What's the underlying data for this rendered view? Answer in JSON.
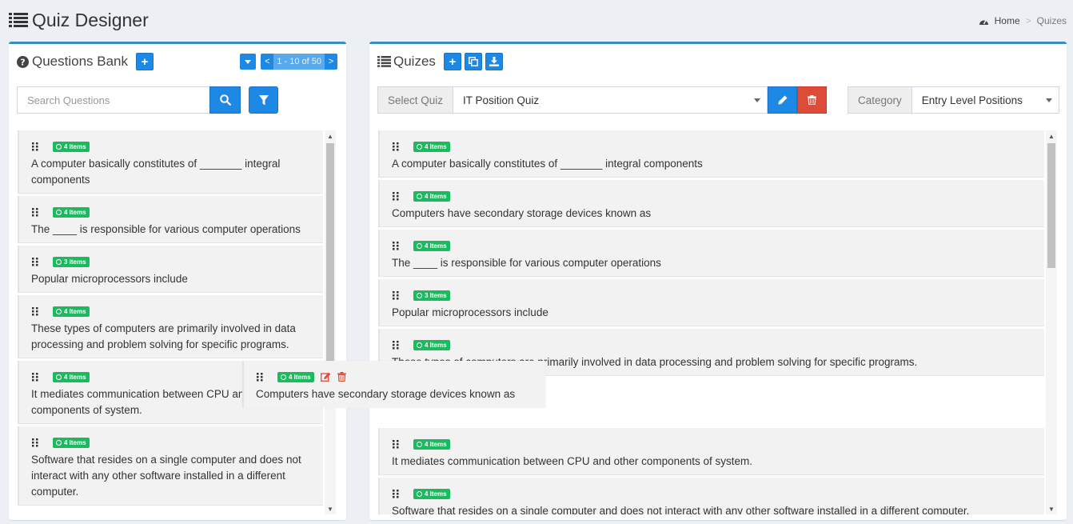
{
  "header": {
    "title": "Quiz Designer"
  },
  "breadcrumb": {
    "home": "Home",
    "current": "Quizes"
  },
  "left_panel": {
    "title": "Questions Bank",
    "pagination": {
      "prev": "<",
      "range": "1 - 10 of 50",
      "next": ">"
    },
    "search_placeholder": "Search Questions",
    "questions": [
      {
        "badge": "4 Items",
        "text": "A computer basically constitutes of _______ integral components"
      },
      {
        "badge": "4 Items",
        "text": "The ____ is responsible for various computer operations"
      },
      {
        "badge": "3 Items",
        "text": "Popular microprocessors include"
      },
      {
        "badge": "4 Items",
        "text": "These types of computers are primarily involved in data processing and problem solving for specific programs."
      },
      {
        "badge": "4 Items",
        "text": "It mediates communication between CPU and other components of system."
      },
      {
        "badge": "4 Items",
        "text": "Software that resides on a single computer and does not interact with any other software installed in a different computer."
      }
    ]
  },
  "right_panel": {
    "title": "Quizes",
    "select_quiz_label": "Select Quiz",
    "selected_quiz": "IT Position Quiz",
    "category_label": "Category",
    "selected_category": "Entry Level Positions",
    "questions": [
      {
        "badge": "4 Items",
        "text": "A computer basically constitutes of _______ integral components"
      },
      {
        "badge": "4 Items",
        "text": "Computers have secondary storage devices known as"
      },
      {
        "badge": "4 Items",
        "text": "The ____ is responsible for various computer operations"
      },
      {
        "badge": "3 Items",
        "text": "Popular microprocessors include"
      },
      {
        "badge": "4 Items",
        "text": "These types of computers are primarily involved in data processing and problem solving for specific programs."
      },
      {
        "badge": "4 Items",
        "text": "It mediates communication between CPU and other components of system."
      },
      {
        "badge": "4 Items",
        "text": "Software that resides on a single computer and does not interact with any other software installed in a different computer."
      }
    ]
  },
  "drag_item": {
    "badge": "4 Items",
    "text": "Computers have secondary storage devices known as"
  },
  "colors": {
    "primary": "#1e88e5",
    "danger": "#dd4b39",
    "success": "#1cba5f",
    "box_border": "#3c8dbc"
  }
}
